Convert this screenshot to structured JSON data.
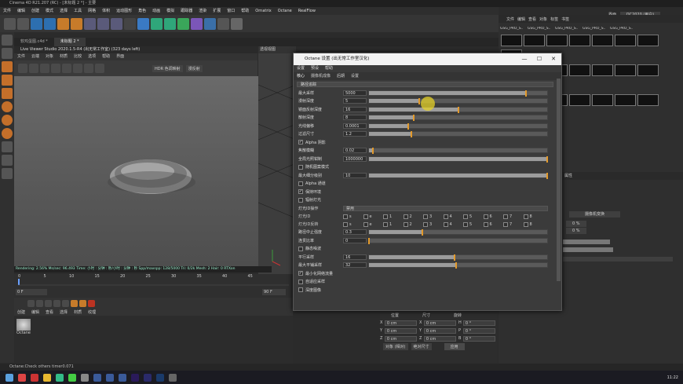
{
  "window": {
    "title": "Cinema 4D R21.207 (RC) - [未标题 2 *] - 主要"
  },
  "menubar": [
    "文件",
    "编辑",
    "创建",
    "模式",
    "选择",
    "工具",
    "网格",
    "体积",
    "运动图形",
    "角色",
    "动画",
    "模拟",
    "跟踪器",
    "渲染",
    "扩展",
    "窗口",
    "帮助",
    "Ornatrix",
    "Octane",
    "RealFlow"
  ],
  "doc_tabs": [
    "软鸡蛋图.c4d *",
    "未标题 2 *"
  ],
  "live_viewer": {
    "title": "Live Viewer Studio 2020.1.5-R4 (出无常工作室) (323 days left)",
    "menu": [
      "文件",
      "云端",
      "对象",
      "材质",
      "比较",
      "选项",
      "帮助",
      "界面"
    ],
    "hdr_label": "HDR 色调映射",
    "mode_label": "漫反射"
  },
  "render_stats": "Rendering: 2.56%   Ms/sec: 96.493   Time: 小时 : 分钟 : 秒/小时 : 分钟 : 秒   Spp/maxspp: 128/5000   Tri: 0/2k   Mesh: 2   Hair: 0   RTXon",
  "dialog": {
    "title": "Octane 设置 (出无常工作室汉化)",
    "controls": {
      "min": "—",
      "max": "☐",
      "close": "✕"
    },
    "menu": [
      "设置",
      "预设",
      "帮助"
    ],
    "tabs": [
      "核心",
      "摄像机成像",
      "后期",
      "设置"
    ],
    "kernel": "路径追踪",
    "params": [
      {
        "label": "最大采样",
        "value": "5000",
        "fill": 0.88
      },
      {
        "label": "漫射深度",
        "value": "5",
        "fill": 0.28,
        "knob": true
      },
      {
        "label": "镜面反射深度",
        "value": "16",
        "fill": 0.5
      },
      {
        "label": "散射深度",
        "value": "8",
        "fill": 0.25
      },
      {
        "label": "光线偏移",
        "value": "0.0001",
        "fill": 0.22
      },
      {
        "label": "过滤尺寸",
        "value": "1.2",
        "fill": 0.24
      }
    ],
    "checks1": [
      {
        "label": "Alpha 阴影",
        "checked": true
      }
    ],
    "params2": [
      {
        "label": "焦散模糊",
        "value": "0.02",
        "fill": 0.02
      },
      {
        "label": "全局光照钳制",
        "value": "1000000",
        "fill": 1.0
      }
    ],
    "checks2": [
      {
        "label": "随机图案模式",
        "checked": false
      }
    ],
    "params3": [
      {
        "label": "最大细分级别",
        "value": "10",
        "fill": 1.0
      }
    ],
    "checks3": [
      {
        "label": "Alpha 通道",
        "checked": false
      },
      {
        "label": "保持环境",
        "checked": true
      },
      {
        "label": "辐射灯光",
        "checked": false
      }
    ],
    "light_mode_label": "灯光ID操作",
    "light_mode_value": "禁用",
    "layer_rows": [
      {
        "label": "灯光ID",
        "cells": [
          "s",
          "e",
          "1",
          "2",
          "3",
          "4",
          "5",
          "6",
          "7",
          "8"
        ]
      },
      {
        "label": "灯光ID反转",
        "cells": [
          "s",
          "e",
          "1",
          "2",
          "3",
          "4",
          "5",
          "6",
          "7",
          "8"
        ]
      }
    ],
    "params4": [
      {
        "label": "路径中止强度",
        "value": "0.3",
        "fill": 0.3
      },
      {
        "label": "连贯比率",
        "value": "0",
        "fill": 0.0
      }
    ],
    "checks4": [
      {
        "label": "静态噪波",
        "checked": false
      }
    ],
    "params5": [
      {
        "label": "平行采样",
        "value": "16",
        "fill": 0.48
      },
      {
        "label": "最大平铺采样",
        "value": "32",
        "fill": 0.49
      }
    ],
    "checks5": [
      {
        "label": "最小化网络流量",
        "checked": true
      },
      {
        "label": "自适应采样",
        "checked": false
      },
      {
        "label": "深度图像",
        "checked": false
      }
    ]
  },
  "timeline": {
    "ticks": [
      "0",
      "5",
      "10",
      "15",
      "20",
      "25",
      "30",
      "35",
      "40",
      "45"
    ],
    "frame_start": "0 F",
    "frame_end": "90 F",
    "current": "0 F"
  },
  "materials": {
    "menu": [
      "创建",
      "编辑",
      "查看",
      "选择",
      "材质",
      "纹理"
    ],
    "item": "Octane"
  },
  "coords": {
    "headers": [
      "位置",
      "尺寸",
      "旋转"
    ],
    "rows": [
      {
        "axis": "X",
        "pos": "0 cm",
        "size": "0 cm",
        "rot_axis": "H",
        "rot": "0 °"
      },
      {
        "axis": "Y",
        "pos": "0 cm",
        "size": "0 cm",
        "rot_axis": "P",
        "rot": "0 °"
      },
      {
        "axis": "Z",
        "pos": "0 cm",
        "size": "0 cm",
        "rot_axis": "B",
        "rot": "0 °"
      }
    ],
    "mode1": "对象 (相对)",
    "mode2": "绝对尺寸",
    "apply": "应用"
  },
  "right_panel": {
    "layout_label": "界面",
    "layout_value": "QC2020 (用户)",
    "tabs": [
      "文件",
      "编辑",
      "查看",
      "对象",
      "标签",
      "书签"
    ],
    "asset_names": [
      "GSG_PRO_S..",
      "GSG_PRO_S..",
      "GSG_PRO_S..",
      "GSG_PRO_S..",
      "GSG_PRO_S.."
    ],
    "attr_title": "属性",
    "attr_value": "0 %",
    "btn_label": "摄像机变换"
  },
  "status": "Octane:Check others timer0.071",
  "clock": "11:22",
  "viewport_label": "透视视图",
  "colors": {
    "accent": "#e39a2c",
    "dialog_bg": "#3b3b3b",
    "viewport": "#606060"
  }
}
